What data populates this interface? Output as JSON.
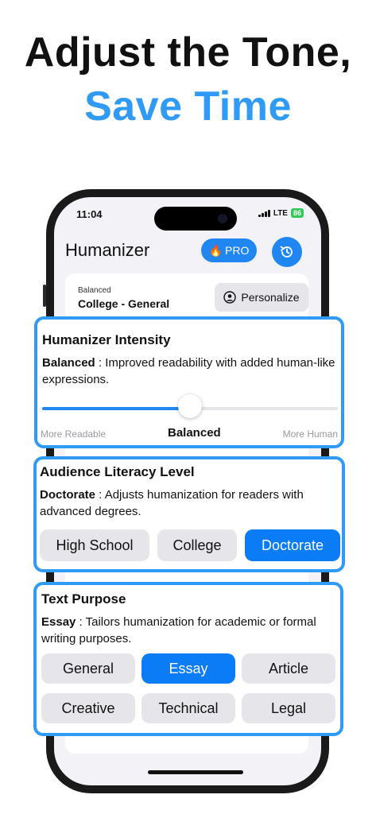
{
  "headline": {
    "line1": "Adjust the Tone,",
    "line2": "Save Time"
  },
  "status_bar": {
    "time": "11:04",
    "network": "LTE",
    "battery": "86"
  },
  "app": {
    "title": "Humanizer",
    "pro_label": "PRO",
    "pro_emoji": "🔥",
    "history_icon": "history-icon"
  },
  "mode_card": {
    "small": "Balanced",
    "main": "College - General",
    "personalize_label": "Personalize"
  },
  "intensity": {
    "title": "Humanizer Intensity",
    "desc_key": "Balanced",
    "desc_text": " : Improved readability with added human-like expressions.",
    "left_label": "More Readable",
    "value_label": "Balanced",
    "right_label": "More Human",
    "level": 0.5
  },
  "literacy": {
    "title": "Audience Literacy Level",
    "desc_key": "Doctorate",
    "desc_text": " : Adjusts humanization for readers with advanced degrees.",
    "options": [
      "High School",
      "College",
      "Doctorate"
    ],
    "selected": "Doctorate"
  },
  "purpose": {
    "title": "Text Purpose",
    "desc_key": "Essay",
    "desc_text": " : Tailors humanization for academic or formal writing purposes.",
    "options": [
      "General",
      "Essay",
      "Article",
      "Creative",
      "Technical",
      "Legal"
    ],
    "selected": "Essay"
  },
  "colors": {
    "accent": "#1f86f2",
    "highlight": "#2f9bf5",
    "pill": "#e5e5ea"
  }
}
